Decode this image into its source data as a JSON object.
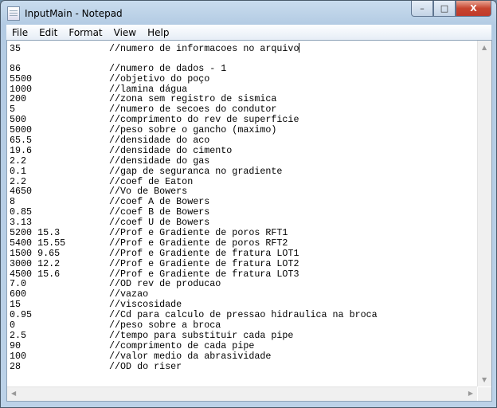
{
  "window": {
    "title": "InputMain - Notepad",
    "minimize": "–",
    "maximize": "□",
    "close": "X"
  },
  "menu": [
    "File",
    "Edit",
    "Format",
    "View",
    "Help"
  ],
  "lines": [
    {
      "v": "35",
      "c": "//numero de informacoes no arquivo"
    },
    {
      "v": "",
      "c": ""
    },
    {
      "v": "86",
      "c": "//numero de dados - 1"
    },
    {
      "v": "5500",
      "c": "//objetivo do poço"
    },
    {
      "v": "1000",
      "c": "//lamina dágua"
    },
    {
      "v": "200",
      "c": "//zona sem registro de sismica"
    },
    {
      "v": "5",
      "c": "//numero de secoes do condutor"
    },
    {
      "v": "500",
      "c": "//comprimento do rev de superficie"
    },
    {
      "v": "5000",
      "c": "//peso sobre o gancho (maximo)"
    },
    {
      "v": "65.5",
      "c": "//densidade do aco"
    },
    {
      "v": "19.6",
      "c": "//densidade do cimento"
    },
    {
      "v": "2.2",
      "c": "//densidade do gas"
    },
    {
      "v": "0.1",
      "c": "//gap de seguranca no gradiente"
    },
    {
      "v": "2.2",
      "c": "//coef de Eaton"
    },
    {
      "v": "4650",
      "c": "//Vo de Bowers"
    },
    {
      "v": "8",
      "c": "//coef A de Bowers"
    },
    {
      "v": "0.85",
      "c": "//coef B de Bowers"
    },
    {
      "v": "3.13",
      "c": "//coef U de Bowers"
    },
    {
      "v": "5200 15.3",
      "c": "//Prof e Gradiente de poros RFT1"
    },
    {
      "v": "5400 15.55",
      "c": "//Prof e Gradiente de poros RFT2"
    },
    {
      "v": "1500 9.65",
      "c": "//Prof e Gradiente de fratura LOT1"
    },
    {
      "v": "3000 12.2",
      "c": "//Prof e Gradiente de fratura LOT2"
    },
    {
      "v": "4500 15.6",
      "c": "//Prof e Gradiente de fratura LOT3"
    },
    {
      "v": "7.0",
      "c": "//OD rev de producao"
    },
    {
      "v": "600",
      "c": "//vazao"
    },
    {
      "v": "15",
      "c": "//viscosidade"
    },
    {
      "v": "0.95",
      "c": "//Cd para calculo de pressao hidraulica na broca"
    },
    {
      "v": "0",
      "c": "//peso sobre a broca"
    },
    {
      "v": "2.5",
      "c": "//tempo para substituir cada pipe"
    },
    {
      "v": "90",
      "c": "//comprimento de cada pipe"
    },
    {
      "v": "100",
      "c": "//valor medio da abrasividade"
    },
    {
      "v": "28",
      "c": "//OD do riser"
    }
  ]
}
